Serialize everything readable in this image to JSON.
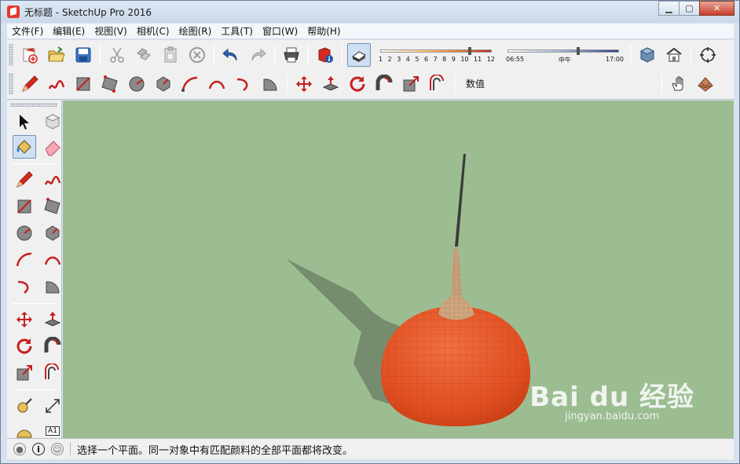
{
  "window": {
    "title": "无标题 - SketchUp Pro 2016",
    "controls": {
      "minimize": "▁",
      "maximize": "▢",
      "close": "✕"
    }
  },
  "menu": [
    "文件(F)",
    "编辑(E)",
    "视图(V)",
    "相机(C)",
    "绘图(R)",
    "工具(T)",
    "窗口(W)",
    "帮助(H)"
  ],
  "toolbar_top": {
    "icons": [
      "new-icon",
      "open-icon",
      "save-icon",
      "cut-icon",
      "copy-icon",
      "paste-icon",
      "erase-icon",
      "undo-icon",
      "redo-icon",
      "print-icon",
      "model-info-icon",
      "shadows-toggle-icon"
    ],
    "shadow_scale": [
      "1",
      "2",
      "3",
      "4",
      "5",
      "6",
      "7",
      "8",
      "9",
      "10",
      "11",
      "12"
    ],
    "time_labels": {
      "start": "06:55",
      "middle": "中午",
      "end": "17:00"
    },
    "right_icons": [
      "iso-view-icon",
      "house-icon",
      "orbit-icon"
    ]
  },
  "toolbar_second": {
    "icons": [
      "pencil-icon",
      "freehand-icon",
      "rectangle-icon",
      "rotated-rectangle-icon",
      "circle-icon",
      "polygon-icon",
      "arc-icon",
      "two-point-arc-icon",
      "three-point-arc-icon",
      "pie-icon",
      "move-icon",
      "push-pull-icon",
      "rotate-icon",
      "follow-me-icon",
      "scale-icon",
      "offset-icon"
    ],
    "measurements_label": "数值",
    "right_icons": [
      "hand-icon",
      "sandbox-icon"
    ]
  },
  "left_toolbar": {
    "rows": [
      [
        "select-arrow-icon",
        "component-icon"
      ],
      [
        "paint-bucket-icon",
        "eraser-icon"
      ],
      [
        "pencil-icon",
        "freehand-icon"
      ],
      [
        "rectangle-icon",
        "rotated-rectangle-icon"
      ],
      [
        "circle-icon",
        "polygon-icon"
      ],
      [
        "arc-icon",
        "two-point-arc-icon"
      ],
      [
        "three-point-arc-icon",
        "pie-icon"
      ],
      [
        "move-icon",
        "push-pull-icon"
      ],
      [
        "rotate-icon",
        "follow-me-icon"
      ],
      [
        "scale-icon",
        "offset-icon"
      ],
      [
        "tape-measure-icon",
        "dimension-icon"
      ],
      [
        "protractor-icon",
        "text-label-icon"
      ]
    ],
    "text_label_glyph": "A1"
  },
  "scene": {
    "ground_color": "#9cbd91",
    "dome_color": "#e8572b",
    "spire_color": "#c9a07b",
    "shadow_color": "#6e8469"
  },
  "status": {
    "message": "选择一个平面。同一对象中有匹配颜料的全部平面都将改变。",
    "icons": [
      "geolocation-icon",
      "info-icon",
      "user-icon"
    ]
  },
  "watermark": {
    "brand": "Bai du 经验",
    "url": "jingyan.baidu.com"
  }
}
